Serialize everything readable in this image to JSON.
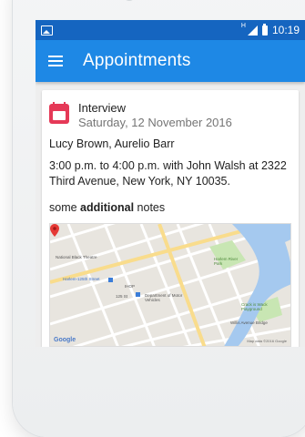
{
  "status_bar": {
    "network_badge": "H",
    "time": "10:19"
  },
  "app_bar": {
    "title": "Appointments"
  },
  "appointment": {
    "title": "Interview",
    "date": "Saturday, 12 November 2016",
    "attendees": "Lucy Brown, Aurelio Barr",
    "when_line1": "3:00 p.m. to 4:00 p.m. with John Walsh at 2322",
    "when_line2": "Third Avenue, New York, NY 10035.",
    "notes_prefix": "some ",
    "notes_bold": "additional",
    "notes_suffix": " notes"
  },
  "map": {
    "labels": {
      "theatre": "National Black Theatre",
      "harlem_station": "Harlem-125th Street",
      "dmv": "Department of Motor Vehicles",
      "park": "Harlem River Park",
      "playground": "Crack is Wack Playground",
      "bridge": "Willis Avenue Bridge",
      "street_125": "125 St",
      "ihop": "IHOP"
    },
    "logo": "Google",
    "credit": "Map data ©2016 Google"
  },
  "colors": {
    "status_bar": "#1565c0",
    "app_bar": "#1e88e5",
    "calendar_icon": "#e53957",
    "river": "#a5c9ef",
    "park": "#c8e6b3"
  }
}
